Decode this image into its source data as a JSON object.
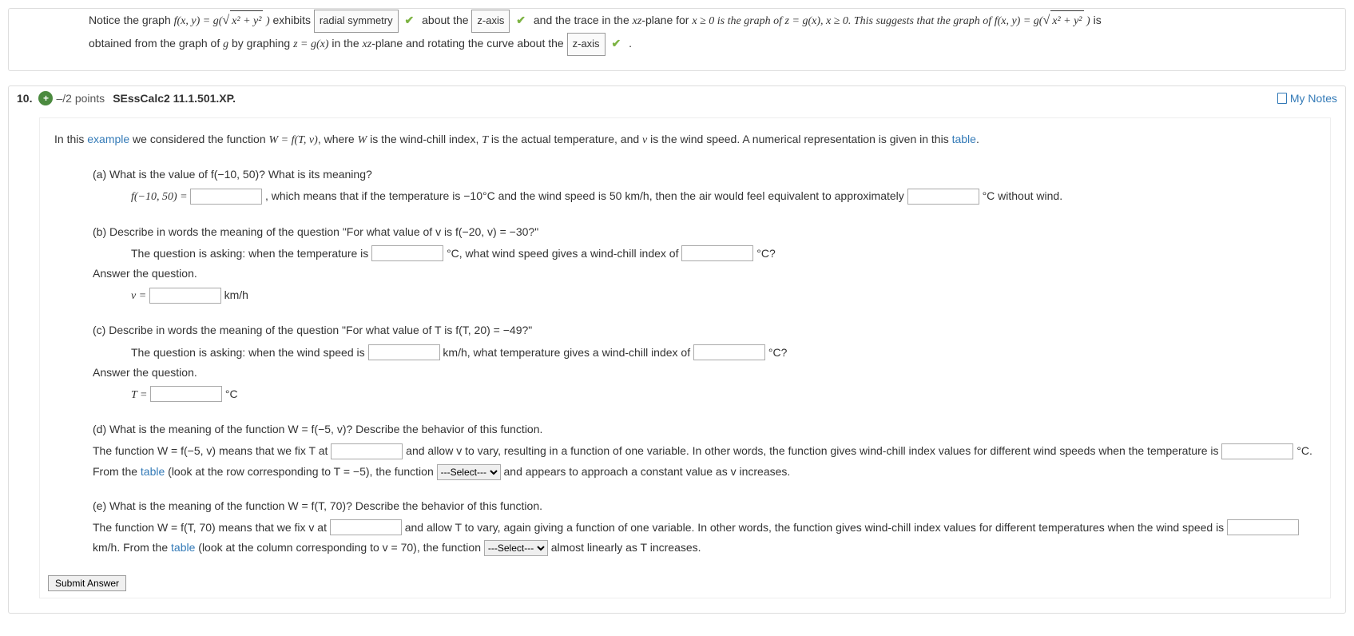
{
  "prev": {
    "line1_a": "Notice the graph  ",
    "fxy": "f(x, y) = g",
    "sqrt_expr": "x² + y²",
    "exhibits": "  exhibits ",
    "ans_radial": "radial symmetry",
    "about": "   about the ",
    "ans_zaxis": "z-axis",
    "trace": "   and the trace in the ",
    "xz": "xz",
    "plane_for": "-plane for ",
    "xge0_1": "x ≥ 0 is the graph of z = g(x), x ≥ 0. This suggests that the graph of  ",
    "is": "  is",
    "line2_a": "obtained from the graph of ",
    "g": "g",
    "by_graph": " by graphing ",
    "zgx": "z = g(x)",
    "in_the": " in the ",
    "plane_rot": "-plane and rotating the curve about the ",
    "period": "   ."
  },
  "q": {
    "num": "10.",
    "points": "–/2 points",
    "source": "SEssCalc2 11.1.501.XP.",
    "mynotes": "My Notes",
    "intro_a": "In this ",
    "intro_example": "example",
    "intro_b": " we considered the function ",
    "intro_func": "W = f(T, v)",
    "intro_c": ", where ",
    "W": "W",
    "intro_d": " is the wind-chill index, ",
    "T": "T",
    "intro_e": " is the actual temperature, and ",
    "v": "v",
    "intro_f": " is the wind speed. A numerical representation is given in this ",
    "intro_table": "table",
    "intro_g": ".",
    "a": {
      "q": "(a) What is the value of  f(−10, 50)?  What is its meaning?",
      "lhs": "f(−10, 50) = ",
      "mid": " ,  which means that if the temperature is −10°C  and the wind speed is 50 km/h, then the air would feel equivalent to approximately ",
      "tail": " °C without wind."
    },
    "b": {
      "q": "(b) Describe in words the meaning of the question \"For what value of v is  f(−20, v) = −30?\"",
      "l1a": "The question is asking: when the temperature is ",
      "l1b": " °C, what wind speed gives a wind-chill index of ",
      "l1c": " °C?",
      "ans_label": "Answer the question.",
      "v_eq": "v = ",
      "unit": " km/h"
    },
    "c": {
      "q": "(c) Describe in words the meaning of the question \"For what value of T is  f(T, 20) = −49?\"",
      "l1a": "The question is asking: when the wind speed is ",
      "l1b": " km/h, what temperature gives a wind-chill index of ",
      "l1c": " °C?",
      "ans_label": "Answer the question.",
      "t_eq": "T = ",
      "unit": " °C"
    },
    "d": {
      "q": "(d) What is the meaning of the function  W = f(−5, v)?  Describe the behavior of this function.",
      "l1a": "The function  W = f(−5, v)  means that we fix T at ",
      "l1b": " and allow v to vary, resulting in a function of one variable. In other words, the function gives wind-chill index values for different wind speeds when the temperature is ",
      "l1c": " °C. From the ",
      "table": "table",
      "l1d": " (look at the row corresponding to  T = −5),  the function ",
      "sel": "---Select---",
      "l1e": " and appears to approach a constant value as v increases."
    },
    "e": {
      "q": "(e) What is the meaning of the function  W = f(T, 70)?  Describe the behavior of this function.",
      "l1a": "The function W = f(T, 70) means that we fix v at ",
      "l1b": " and allow T to vary, again giving a function of one variable. In other words, the function gives wind-chill index values for different temperatures when the wind speed is ",
      "l1c": " km/h. From the ",
      "table": "table",
      "l1d": " (look at the column corresponding to v = 70), the function ",
      "sel": "---Select---",
      "l1e": " almost linearly as T increases."
    },
    "submit": "Submit Answer"
  }
}
